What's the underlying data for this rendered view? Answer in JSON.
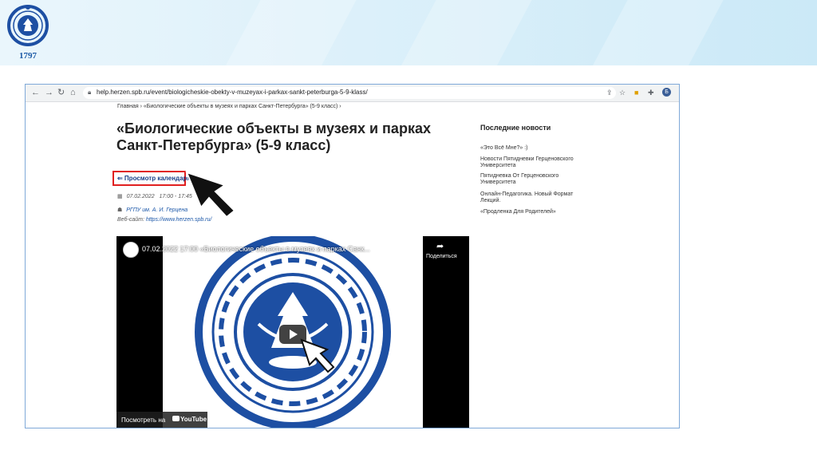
{
  "banner": {
    "year": "1797"
  },
  "browser": {
    "url": "help.herzen.spb.ru/event/biologicheskie-obekty-v-muzeyax-i-parkax-sankt-peterburga-5-9-klass/",
    "back_icon": "arrow-left-icon",
    "forward_icon": "arrow-right-icon",
    "reload_icon": "reload-icon",
    "home_icon": "home-icon",
    "avatar_initial": "Б"
  },
  "breadcrumb": {
    "home": "Главная",
    "sep1": "›",
    "current": "«Биологические объекты в музеях и парках Санкт-Петербурга» (5-9 класс)",
    "sep2": "›"
  },
  "event": {
    "title_line1": "«Биологические объекты в музеях и парках",
    "title_line2": "Санкт-Петербурга» (5-9 класс)",
    "calendar_link": "⇐ Просмотр календаря",
    "date": "07.02.2022",
    "time": "17:00 - 17:45",
    "organizer": "РГПУ им. А. И. Герцена",
    "website_label": "Веб-сайт:",
    "website_url": "https://www.herzen.spb.ru/"
  },
  "video": {
    "title": "07.02.2022 17:00 «Биологические объекты в музеях и парках Санк...",
    "share_label": "Поделиться",
    "watch_on": "Посмотреть на",
    "youtube": "YouTube"
  },
  "sidebar": {
    "title": "Последние новости",
    "items": [
      {
        "label": "«Это Всё Мне?» :)"
      },
      {
        "label": "Новости Пятидневки Герценовского Университета"
      },
      {
        "label": "Пятидневка От Герценовского Университета"
      },
      {
        "label": "Онлайн-Педагогика. Новый Формат Лекций."
      },
      {
        "label": "«Продленка Для Родителей»"
      }
    ]
  },
  "colors": {
    "accent_blue": "#1a3f88",
    "highlight_red": "#e02020",
    "seal_blue": "#1d4fa3",
    "banner_blue": "#d7eef9"
  }
}
